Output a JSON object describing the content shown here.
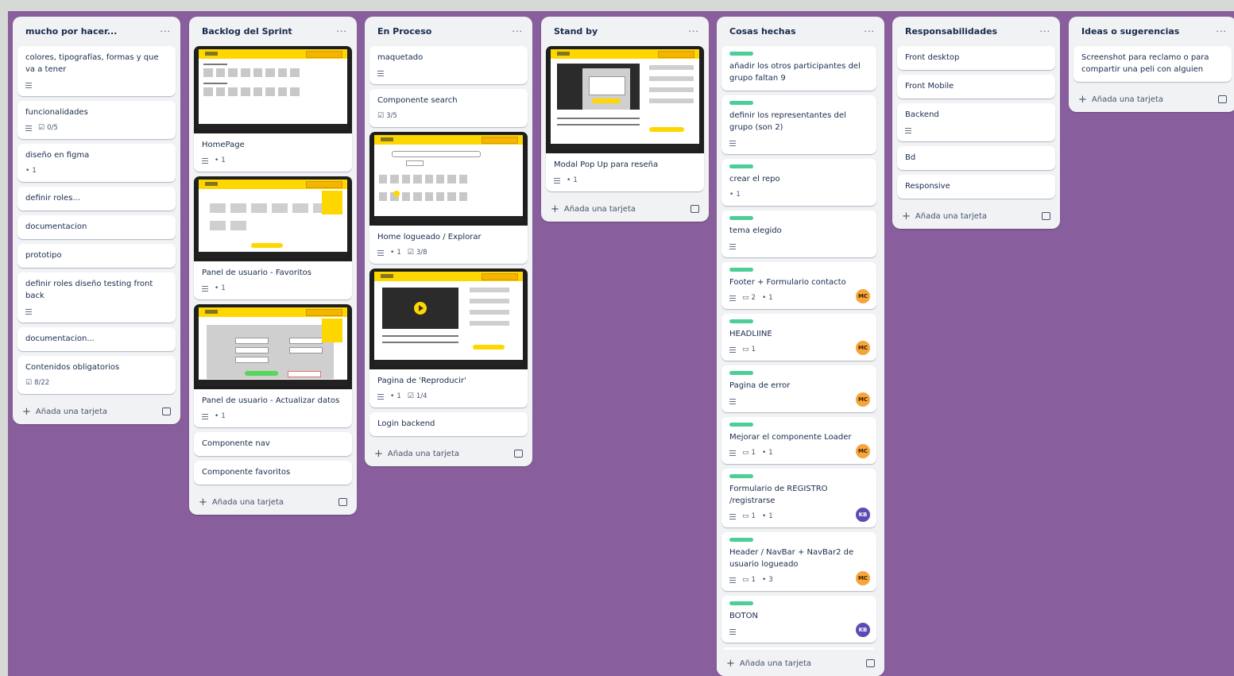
{
  "lists": [
    {
      "title": "mucho por hacer...",
      "add_label": "Añada una tarjeta",
      "cards": [
        {
          "title": "colores, tipografías, formas y que va a tener",
          "desc": true
        },
        {
          "title": "funcionalidades",
          "desc": true,
          "checklist": "0/5"
        },
        {
          "title": "diseño en figma",
          "attachments": "1"
        },
        {
          "title": "definir roles..."
        },
        {
          "title": "documentacion"
        },
        {
          "title": "prototipo"
        },
        {
          "title": "definir roles diseño testing front back",
          "desc": true
        },
        {
          "title": "documentacion..."
        },
        {
          "title": "Contenidos obligatorios",
          "checklist": "8/22"
        }
      ]
    },
    {
      "title": "Backlog del Sprint",
      "add_label": "Añada una tarjeta",
      "cards": [
        {
          "title": "HomePage",
          "desc": true,
          "attachments": "1",
          "cover": "home"
        },
        {
          "title": "Panel de usuario - Favoritos",
          "desc": true,
          "attachments": "1",
          "cover": "favs"
        },
        {
          "title": "Panel de usuario - Actualizar datos",
          "desc": true,
          "attachments": "1",
          "cover": "form"
        },
        {
          "title": "Componente nav"
        },
        {
          "title": "Componente favoritos"
        }
      ]
    },
    {
      "title": "En Proceso",
      "add_label": "Añada una tarjeta",
      "cards": [
        {
          "title": "maquetado",
          "desc": true
        },
        {
          "title": "Componente search",
          "checklist": "3/5"
        },
        {
          "title": "Home logueado / Explorar",
          "desc": true,
          "attachments": "1",
          "checklist": "3/8",
          "cover": "explore"
        },
        {
          "title": "Pagina de 'Reproducir'",
          "desc": true,
          "attachments": "1",
          "checklist": "1/4",
          "cover": "player"
        },
        {
          "title": "Login backend"
        }
      ]
    },
    {
      "title": "Stand by",
      "add_label": "Añada una tarjeta",
      "cards": [
        {
          "title": "Modal Pop Up para reseña",
          "desc": true,
          "attachments": "1",
          "cover": "modal"
        }
      ]
    },
    {
      "title": "Cosas hechas",
      "add_label": "Añada una tarjeta",
      "cards": [
        {
          "title": "añadir los otros participantes del grupo faltan 9",
          "label": true
        },
        {
          "title": "definir los representantes del grupo (son 2)",
          "label": true,
          "desc": true
        },
        {
          "title": "crear el repo",
          "label": true,
          "attachments": "1"
        },
        {
          "title": "tema elegido",
          "label": true,
          "desc": true
        },
        {
          "title": "Footer + Formulario contacto",
          "label": true,
          "desc": true,
          "comments": "2",
          "attachments": "1",
          "avatar": "MC"
        },
        {
          "title": "HEADLIINE",
          "label": true,
          "desc": true,
          "comments": "1",
          "avatar": "MC"
        },
        {
          "title": "Pagina de error",
          "label": true,
          "desc": true,
          "avatar": "MC"
        },
        {
          "title": "Mejorar el componente Loader",
          "label": true,
          "desc": true,
          "comments": "1",
          "attachments": "1",
          "avatar": "MC"
        },
        {
          "title": "Formulario de REGISTRO /registrarse",
          "label": true,
          "desc": true,
          "comments": "1",
          "attachments": "1",
          "avatar": "KB"
        },
        {
          "title": "Header / NavBar + NavBar2 de usuario logueado",
          "label": true,
          "desc": true,
          "comments": "1",
          "attachments": "3",
          "avatar": "MC"
        },
        {
          "title": "BOTON",
          "label": true,
          "desc": true,
          "avatar": "KB"
        }
      ]
    },
    {
      "title": "Responsabilidades",
      "add_label": "Añada una tarjeta",
      "cards": [
        {
          "title": "Front desktop"
        },
        {
          "title": "Front Mobile"
        },
        {
          "title": "Backend",
          "desc": true
        },
        {
          "title": "Bd"
        },
        {
          "title": "Responsive"
        }
      ]
    },
    {
      "title": "Ideas o sugerencias",
      "add_label": "Añada una tarjeta",
      "cards": [
        {
          "title": "Screenshot para reclamo o para compartir una peli con alguien"
        }
      ]
    }
  ],
  "colors": {
    "board": "#885e9d",
    "label_green": "#4bce97",
    "avatar_mc": "#f5a53b",
    "avatar_kb": "#5b4bb3"
  }
}
